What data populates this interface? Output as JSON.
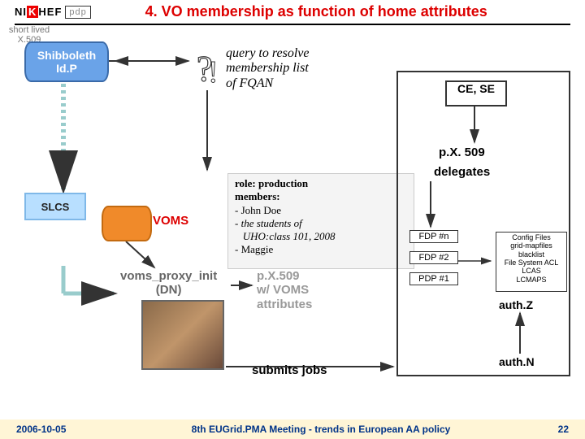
{
  "header": {
    "logo_main": "NI",
    "logo_k": "K",
    "logo_hef": "HEF",
    "logo_pdp": "pdp",
    "title": "4. VO membership as function of home attributes"
  },
  "shib": "Shibboleth\nId.P",
  "slcs": "SLCS",
  "x509_note": "short lived\nX.509",
  "voms": "VOMS",
  "query": {
    "l1": "query to resolve",
    "l2": "membership list",
    "l3": "of FQAN"
  },
  "role": {
    "h1": "role: production",
    "h2": "members:",
    "m1": "- John Doe",
    "m2": "- the students of",
    "m3": "   UHO:class 101, 2008",
    "m4": "- Maggie"
  },
  "vpi": {
    "l1": "voms_proxy_init",
    "l2": "(DN)"
  },
  "attrs": {
    "l1": "p.X.509",
    "l2": "w/ VOMS",
    "l3": "attributes"
  },
  "submits": "submits jobs",
  "right": {
    "cese": "CE, SE",
    "px509": "p.X. 509",
    "delegates": "delegates",
    "pdp1": "FDP #n",
    "pdp2": "FDP #2",
    "pdp3": "PDP #1",
    "cfg": "Config Files\ngrid-mapfiles\nblacklist\nFile System ACL\nLCAS\nLCMAPS",
    "authz": "auth.Z",
    "authn": "auth.N"
  },
  "footer": {
    "date": "2006-10-05",
    "mid": "8th EUGrid.PMA Meeting - trends in European AA policy",
    "page": "22"
  }
}
